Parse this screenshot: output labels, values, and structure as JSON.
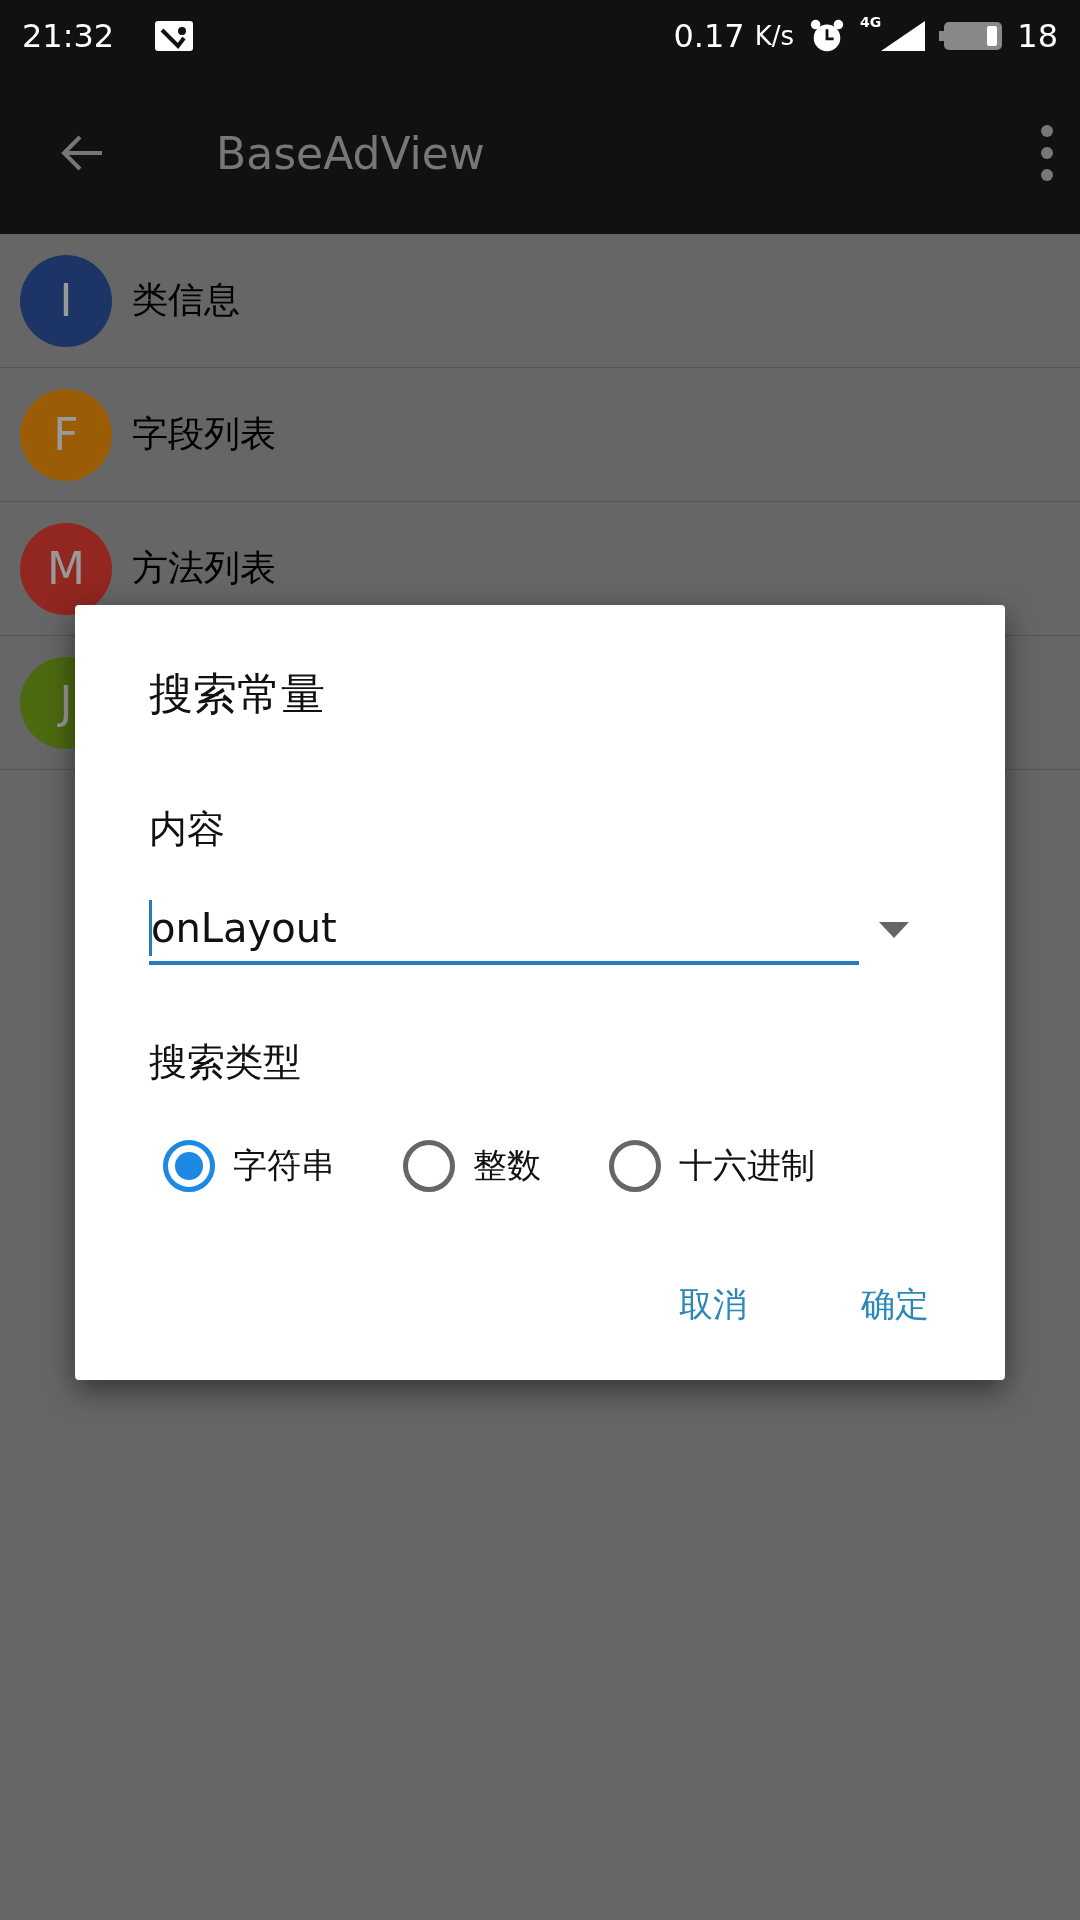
{
  "status_bar": {
    "time": "21:32",
    "speed": "0.17",
    "speed_unit": "K/s",
    "network": "4G",
    "battery": "18"
  },
  "app_bar": {
    "title": "BaseAdView"
  },
  "list": [
    {
      "letter": "I",
      "label": "类信息",
      "color": "#1c3566"
    },
    {
      "letter": "F",
      "label": "字段列表",
      "color": "#9a5c05"
    },
    {
      "letter": "M",
      "label": "方法列表",
      "color": "#922620"
    },
    {
      "letter": "J",
      "color": "#4c6a10"
    }
  ],
  "dialog": {
    "title": "搜索常量",
    "content_label": "内容",
    "content_value": "onLayout",
    "type_label": "搜索类型",
    "types": [
      {
        "label": "字符串",
        "selected": true
      },
      {
        "label": "整数",
        "selected": false
      },
      {
        "label": "十六进制",
        "selected": false
      }
    ],
    "buttons": [
      "取消",
      "确定"
    ]
  }
}
